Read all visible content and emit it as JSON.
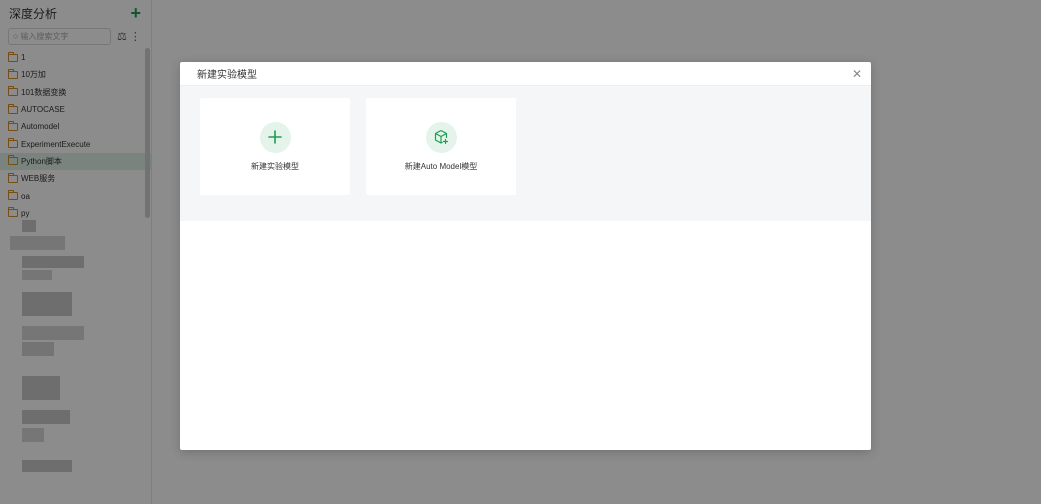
{
  "sidebar": {
    "title": "深度分析",
    "search": {
      "placeholder": "输入搜索文字"
    },
    "items": [
      {
        "label": "1"
      },
      {
        "label": "10万加"
      },
      {
        "label": "101数据变换"
      },
      {
        "label": "AUTOCASE"
      },
      {
        "label": "Automodel"
      },
      {
        "label": "ExperimentExecute"
      },
      {
        "label": "Python脚本"
      },
      {
        "label": "WEB服务"
      },
      {
        "label": "oa"
      },
      {
        "label": "py"
      }
    ]
  },
  "modal": {
    "title": "新建实验模型",
    "cards": [
      {
        "label": "新建实验模型",
        "icon": "plus-icon"
      },
      {
        "label": "新建Auto Model模型",
        "icon": "cube-plus-icon"
      }
    ]
  },
  "colors": {
    "accent": "#1f9d55",
    "folder": "#d98c28"
  }
}
